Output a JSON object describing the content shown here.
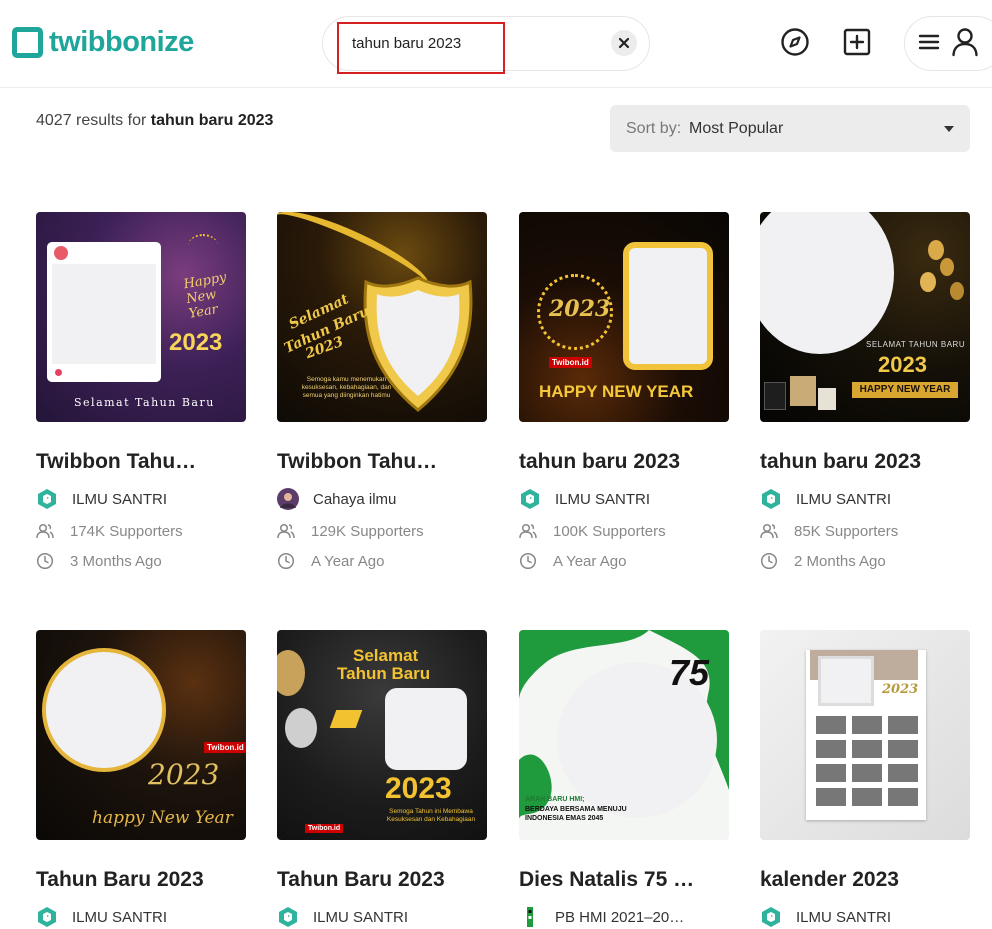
{
  "header": {
    "logo_text": "twibbonize",
    "search_value": "tahun baru 2023",
    "icons": [
      "explore-icon",
      "add-icon",
      "menu-icon",
      "user-icon"
    ]
  },
  "results": {
    "count": "4027",
    "text": "results for",
    "query": "tahun baru 2023"
  },
  "sort": {
    "label": "Sort by:",
    "value": "Most Popular"
  },
  "cards": [
    {
      "title": "Twibbon Tahu…",
      "creator": "ILMU SANTRI",
      "supporters": "174K Supporters",
      "age": "3 Months Ago",
      "thumb_text": [
        "Selamat Tahun Baru",
        "Happy New Year",
        "2023"
      ]
    },
    {
      "title": "Twibbon Tahu…",
      "creator": "Cahaya ilmu",
      "supporters": "129K Supporters",
      "age": "A Year Ago",
      "thumb_text": [
        "Selamat",
        "Tahun Baru",
        "2023",
        "Semoga kamu menemukan kesuksesan, kebahagiaan, dan semua yang diinginkan hatimu"
      ]
    },
    {
      "title": "tahun baru 2023",
      "creator": "ILMU SANTRI",
      "supporters": "100K Supporters",
      "age": "A Year Ago",
      "thumb_text": [
        "2023",
        "Twibon.id",
        "HAPPY NEW YEAR"
      ]
    },
    {
      "title": "tahun baru 2023",
      "creator": "ILMU SANTRI",
      "supporters": "85K Supporters",
      "age": "2 Months Ago",
      "thumb_text": [
        "SELAMAT TAHUN BARU",
        "2023",
        "HAPPY NEW YEAR"
      ]
    },
    {
      "title": "Tahun Baru 2023",
      "creator": "ILMU SANTRI",
      "thumb_text": [
        "Twibon.id",
        "2023",
        "happy New Year"
      ]
    },
    {
      "title": "Tahun Baru 2023",
      "creator": "ILMU SANTRI",
      "thumb_text": [
        "Selamat",
        "Tahun Baru",
        "2023",
        "Semoga Tahun ini Membawa Kesuksesan dan Kebahagiaan",
        "Twibon.id"
      ]
    },
    {
      "title": "Dies Natalis 75 …",
      "creator": "PB HMI 2021–20…",
      "thumb_text": [
        "75",
        "ARAH BARU HMI;",
        "BERDAYA BERSAMA MENUJU",
        "INDONESIA EMAS 2045"
      ]
    },
    {
      "title": "kalender 2023",
      "creator": "ILMU SANTRI",
      "thumb_text": [
        "2023"
      ]
    }
  ],
  "colors": {
    "brand": "#1fa69a",
    "highlight": "#d42020",
    "gold": "#f2c230"
  }
}
